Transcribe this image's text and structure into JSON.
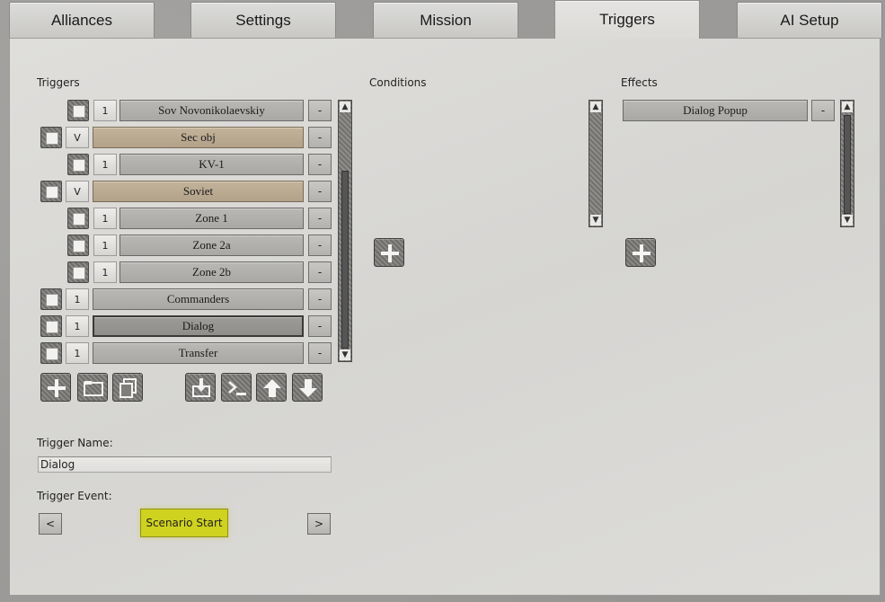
{
  "tabs": [
    {
      "label": "Alliances"
    },
    {
      "label": "Settings"
    },
    {
      "label": "Mission"
    },
    {
      "label": "Triggers",
      "active": true
    },
    {
      "label": "AI Setup"
    }
  ],
  "sections": {
    "triggers": "Triggers",
    "conditions": "Conditions",
    "effects": "Effects"
  },
  "trigger_list": [
    {
      "indent": true,
      "count": "1",
      "label": "Sov Novonikolaevskiy",
      "type": "trigger"
    },
    {
      "indent": false,
      "count": "V",
      "label": "Sec obj",
      "type": "folder"
    },
    {
      "indent": true,
      "count": "1",
      "label": "KV-1",
      "type": "trigger"
    },
    {
      "indent": false,
      "count": "V",
      "label": "Soviet",
      "type": "folder"
    },
    {
      "indent": true,
      "count": "1",
      "label": "Zone 1",
      "type": "trigger"
    },
    {
      "indent": true,
      "count": "1",
      "label": "Zone 2a",
      "type": "trigger"
    },
    {
      "indent": true,
      "count": "1",
      "label": "Zone 2b",
      "type": "trigger"
    },
    {
      "indent": false,
      "count": "1",
      "label": "Commanders",
      "type": "trigger"
    },
    {
      "indent": false,
      "count": "1",
      "label": "Dialog",
      "type": "trigger",
      "selected": true
    },
    {
      "indent": false,
      "count": "1",
      "label": "Transfer",
      "type": "trigger"
    }
  ],
  "remove_label": "-",
  "effects_list": [
    {
      "label": "Dialog Popup"
    }
  ],
  "toolbar_icons": [
    "add-icon",
    "folder-icon",
    "copy-icon",
    "import-icon",
    "console-icon",
    "move-up-icon",
    "move-down-icon"
  ],
  "trigger_name": {
    "label": "Trigger Name:",
    "value": "Dialog"
  },
  "trigger_event": {
    "label": "Trigger Event:",
    "prev": "<",
    "next": ">",
    "value": "Scenario Start"
  },
  "colors": {
    "folder_row": "#c3b39a",
    "event_highlight": "#cfd21f"
  }
}
